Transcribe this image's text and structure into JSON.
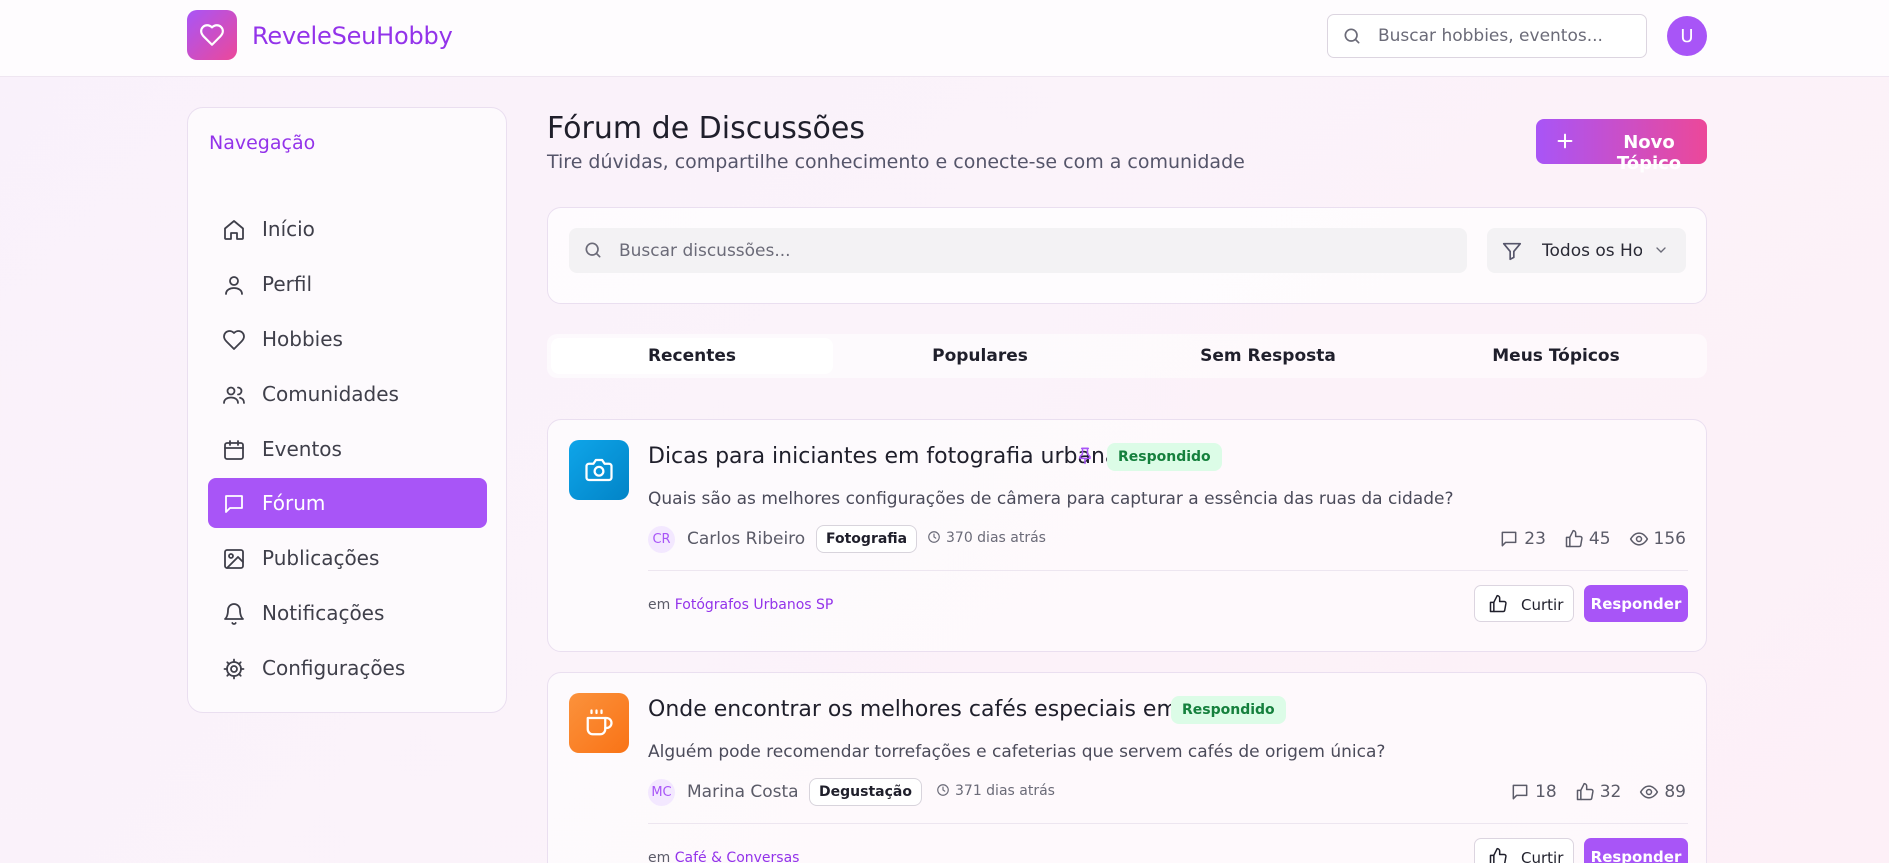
{
  "header": {
    "app_name": "ReveleSeuHobby",
    "search_placeholder": "Buscar hobbies, eventos...",
    "user_initial": "U"
  },
  "sidebar": {
    "title": "Navegação",
    "items": [
      {
        "label": "Início",
        "icon": "home-icon",
        "active": false
      },
      {
        "label": "Perfil",
        "icon": "user-icon",
        "active": false
      },
      {
        "label": "Hobbies",
        "icon": "heart-icon",
        "active": false
      },
      {
        "label": "Comunidades",
        "icon": "users-icon",
        "active": false
      },
      {
        "label": "Eventos",
        "icon": "calendar-icon",
        "active": false
      },
      {
        "label": "Fórum",
        "icon": "message-square-icon",
        "active": true
      },
      {
        "label": "Publicações",
        "icon": "image-icon",
        "active": false
      },
      {
        "label": "Notificações",
        "icon": "bell-icon",
        "active": false
      },
      {
        "label": "Configurações",
        "icon": "gear-icon",
        "active": false
      }
    ]
  },
  "main": {
    "title": "Fórum de Discussões",
    "subtitle": "Tire dúvidas, compartilhe conhecimento e conecte-se com a comunidade",
    "new_topic_label": "Novo Tópico",
    "search_placeholder": "Buscar discussões...",
    "hobby_filter_value": "Todos os Hobbies",
    "tabs": [
      {
        "label": "Recentes",
        "active": true
      },
      {
        "label": "Populares",
        "active": false
      },
      {
        "label": "Sem Resposta",
        "active": false
      },
      {
        "label": "Meus Tópicos",
        "active": false
      }
    ],
    "topics": [
      {
        "title": "Dicas para iniciantes em fotografia urbana",
        "pinned": true,
        "status": "Respondido",
        "description": "Quais são as melhores configurações de câmera para capturar a essência das ruas da cidade?",
        "author_initials": "CR",
        "author": "Carlos Ribeiro",
        "tag": "Fotografia",
        "time": "370 dias atrás",
        "comments": "23",
        "likes": "45",
        "views": "156",
        "community_prefix": "em",
        "community": "Fotógrafos Urbanos SP",
        "like_label": "Curtir",
        "reply_label": "Responder",
        "icon": "camera-icon"
      },
      {
        "title": "Onde encontrar os melhores cafés especiais em SP?",
        "pinned": false,
        "status": "Respondido",
        "description": "Alguém pode recomendar torrefações e cafeterias que servem cafés de origem única?",
        "author_initials": "MC",
        "author": "Marina Costa",
        "tag": "Degustação",
        "time": "371 dias atrás",
        "comments": "18",
        "likes": "32",
        "views": "89",
        "community_prefix": "em",
        "community": "Café & Conversas",
        "like_label": "Curtir",
        "reply_label": "Responder",
        "icon": "coffee-icon"
      }
    ]
  },
  "colors": {
    "accent": "#a855f7",
    "accent_pink": "#ec4899",
    "status_green": "#15803d",
    "camera_blue": "#0ea5e9",
    "coffee_orange": "#f97316"
  }
}
